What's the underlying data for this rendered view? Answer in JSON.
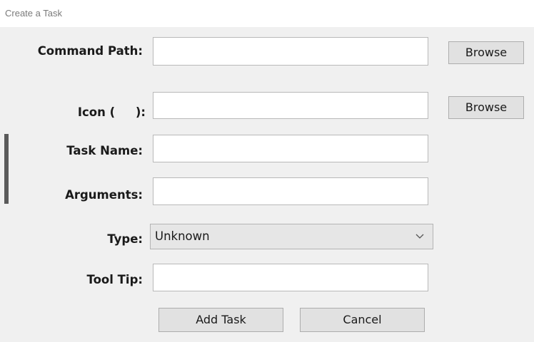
{
  "window": {
    "title": "Create a Task"
  },
  "form": {
    "command_path": {
      "label": "Command Path:",
      "value": "",
      "browse_label": "Browse"
    },
    "icon": {
      "label": "Icon (     ):",
      "value": "",
      "browse_label": "Browse"
    },
    "task_name": {
      "label": "Task Name:",
      "value": ""
    },
    "arguments": {
      "label": "Arguments:",
      "value": ""
    },
    "type": {
      "label": "Type:",
      "selected": "Unknown",
      "chevron_icon": "chevron-down-icon"
    },
    "tool_tip": {
      "label": "Tool Tip:",
      "value": ""
    }
  },
  "actions": {
    "add_task_label": "Add Task",
    "cancel_label": "Cancel"
  },
  "colors": {
    "background": "#f0f0f0",
    "button_face": "#e1e1e1",
    "select_face": "#e6e6e6"
  }
}
